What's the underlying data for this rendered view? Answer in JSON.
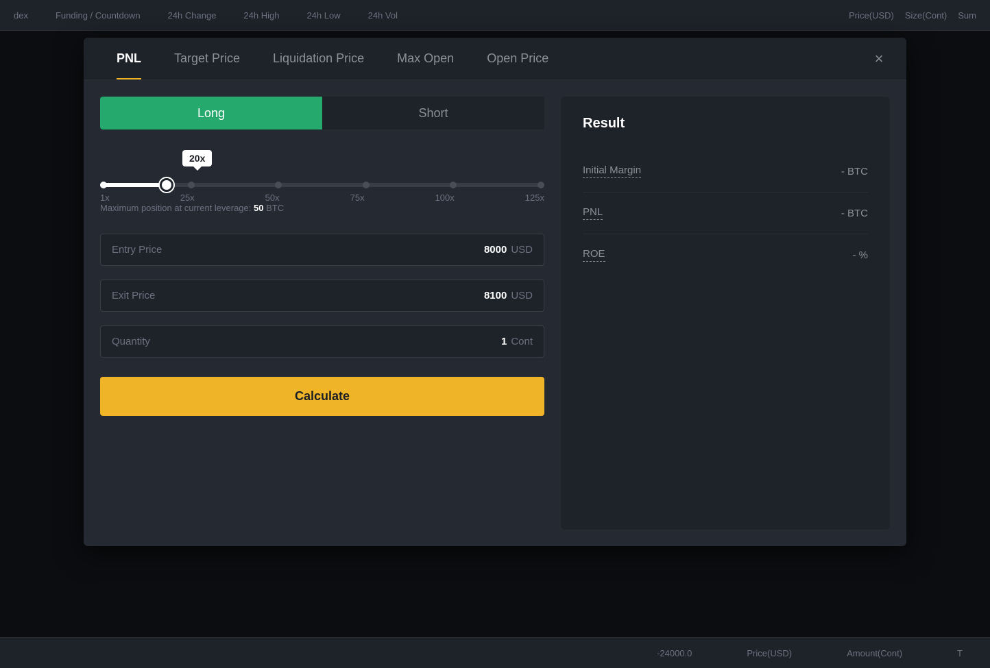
{
  "topbar": {
    "items": [
      {
        "label": "Funding / Countdown"
      },
      {
        "label": "24h Change"
      },
      {
        "label": "24h High"
      },
      {
        "label": "24h Low"
      },
      {
        "label": "24h Vol"
      }
    ],
    "right_labels": [
      "Price(USD)",
      "Size(Cont)",
      "Sum"
    ]
  },
  "bottombar": {
    "items": [
      {
        "label": "-24000.0"
      },
      {
        "label": "Price(USD)"
      },
      {
        "label": "Amount(Cont)"
      },
      {
        "label": "T"
      }
    ]
  },
  "modal": {
    "tabs": [
      {
        "label": "PNL",
        "active": true
      },
      {
        "label": "Target Price"
      },
      {
        "label": "Liquidation Price"
      },
      {
        "label": "Max Open"
      },
      {
        "label": "Open Price"
      }
    ],
    "close_label": "×"
  },
  "left_panel": {
    "toggle": {
      "long_label": "Long",
      "short_label": "Short"
    },
    "leverage": {
      "tooltip": "20x",
      "labels": [
        "1x",
        "25x",
        "50x",
        "75x",
        "100x",
        "125x"
      ]
    },
    "max_position_prefix": "Maximum position at current leverage:",
    "max_position_value": "50",
    "max_position_unit": "BTC",
    "entry_price": {
      "label": "Entry Price",
      "value": "8000",
      "unit": "USD"
    },
    "exit_price": {
      "label": "Exit Price",
      "value": "8100",
      "unit": "USD"
    },
    "quantity": {
      "label": "Quantity",
      "value": "1",
      "unit": "Cont"
    },
    "calculate_btn": "Calculate"
  },
  "right_panel": {
    "title": "Result",
    "rows": [
      {
        "label": "Initial Margin",
        "value": "- BTC"
      },
      {
        "label": "PNL",
        "value": "- BTC"
      },
      {
        "label": "ROE",
        "value": "- %"
      }
    ]
  }
}
